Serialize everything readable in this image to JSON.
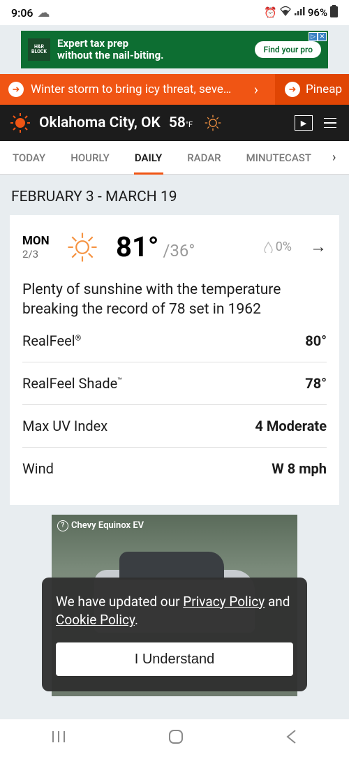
{
  "status": {
    "time": "9:06",
    "battery_pct": "96%"
  },
  "ad_top": {
    "logo": "H&R BLOCK",
    "line1": "Expert tax prep",
    "line2": "without the nail-biting.",
    "cta": "Find your pro"
  },
  "ticker": {
    "main": "Winter storm to bring icy threat, severe ...",
    "right": "Pineap"
  },
  "location": {
    "name": "Oklahoma City, OK",
    "temp": "58",
    "unit": "°F"
  },
  "tabs": [
    "TODAY",
    "HOURLY",
    "DAILY",
    "RADAR",
    "MINUTECAST"
  ],
  "active_tab": 2,
  "date_range": "FEBRUARY 3 - MARCH 19",
  "day": {
    "dow": "MON",
    "date": "2/3",
    "hi": "81°",
    "lo": "/36°",
    "precip": "0%",
    "desc": "Plenty of sunshine with the temperature breaking the record of 78 set in 1962",
    "details": [
      {
        "label": "RealFeel",
        "sup": "®",
        "value": "80°"
      },
      {
        "label": "RealFeel Shade",
        "sup": "™",
        "value": "78°"
      },
      {
        "label": "Max UV Index",
        "sup": "",
        "value": "4 Moderate"
      },
      {
        "label": "Wind",
        "sup": "",
        "value": "W 8 mph"
      }
    ]
  },
  "ad_video": {
    "label": "Chevy Equinox EV"
  },
  "consent": {
    "pre": "We have updated our ",
    "link1": "Privacy Policy",
    "mid": " and ",
    "link2": "Cookie Policy",
    "post": ".",
    "button": "I Understand"
  }
}
